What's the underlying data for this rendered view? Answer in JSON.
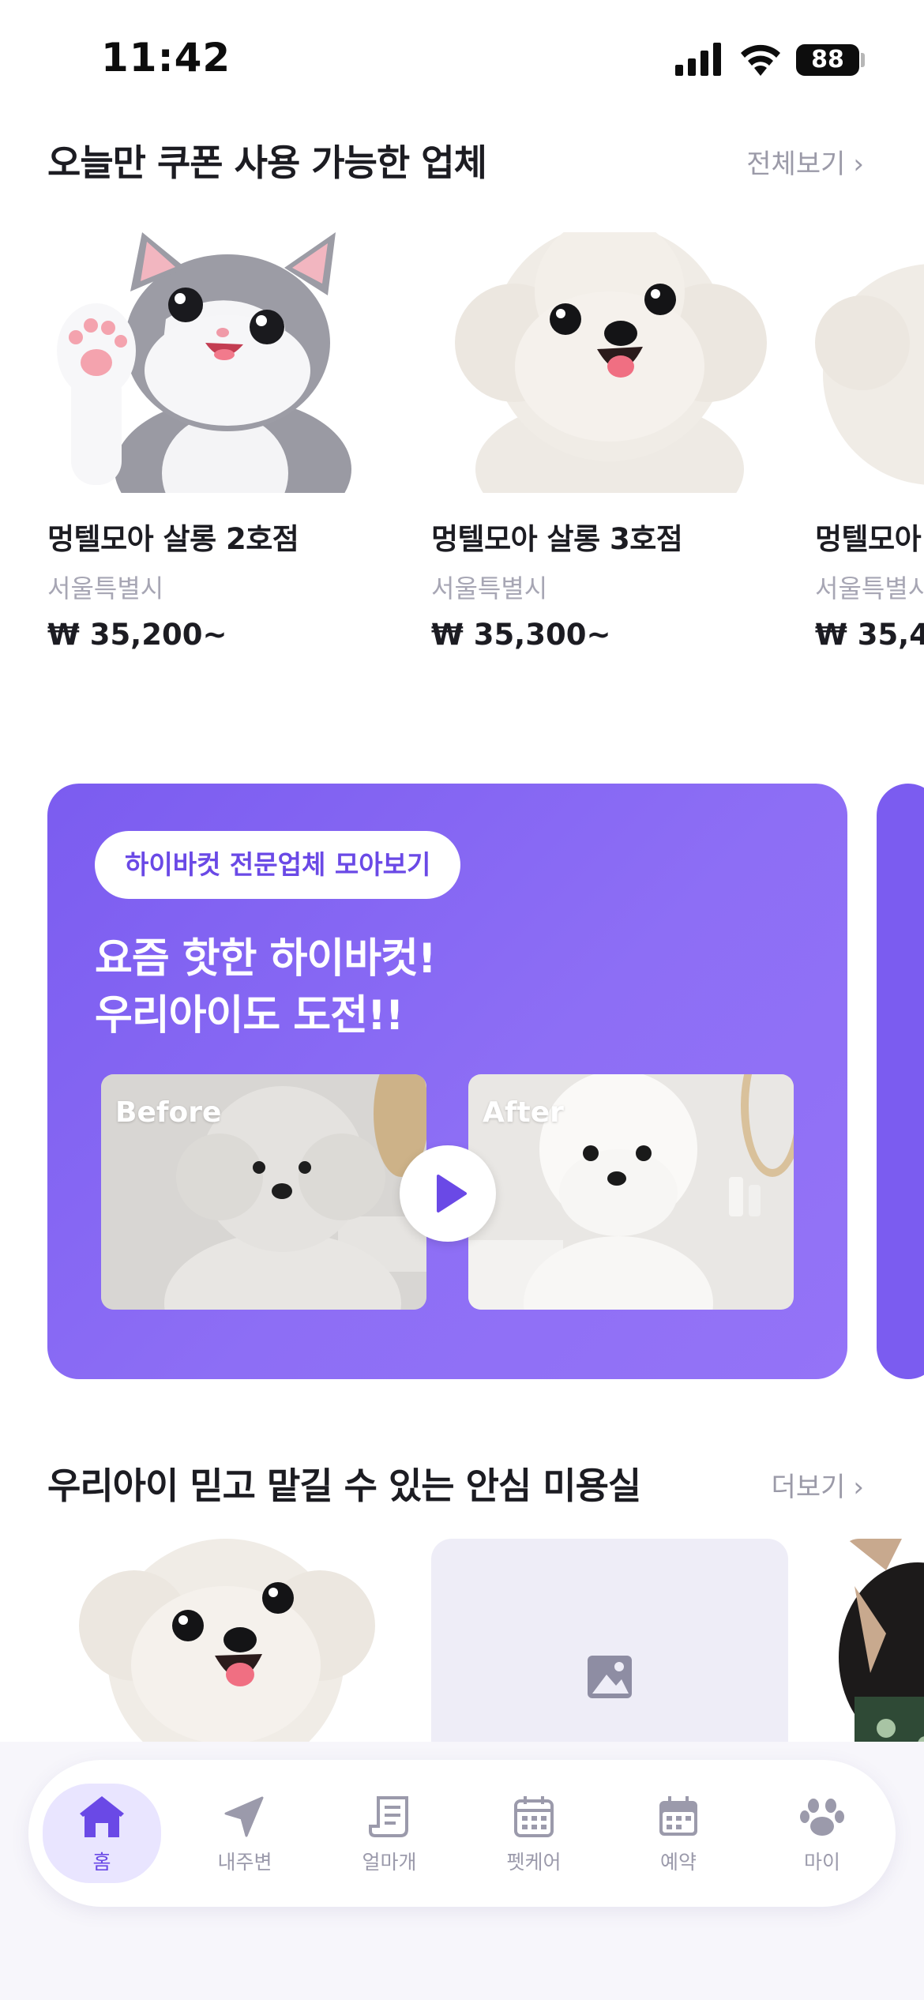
{
  "status_bar": {
    "time": "11:42",
    "battery": "88"
  },
  "coupon_section": {
    "title": "오늘만 쿠폰 사용 가능한 업체",
    "see_all": "전체보기",
    "items": [
      {
        "name": "멍텔모아 살롱 2호점",
        "location": "서울특별시",
        "price": "₩ 35,200~",
        "image": "gray-white-kitten-waving"
      },
      {
        "name": "멍텔모아 살롱 3호점",
        "location": "서울특별시",
        "price": "₩ 35,300~",
        "image": "white-bichon-puppy"
      },
      {
        "name": "멍텔모아",
        "location": "서울특별시",
        "price": "₩ 35,4",
        "image": "white-bichon-puppy"
      }
    ]
  },
  "promo_banner": {
    "chip": "하이바컷 전문업체 모아보기",
    "headline_line1": "요즘 핫한 하이바컷!",
    "headline_line2": "우리아이도 도전!!",
    "before_label": "Before",
    "after_label": "After",
    "accent_color": "#7b5cf0"
  },
  "salon_section": {
    "title": "우리아이 믿고 맡길 수 있는 안심 미용실",
    "more": "더보기",
    "items": [
      {
        "image": "white-bichon-puppy"
      },
      {
        "image": "image-placeholder"
      },
      {
        "image": "black-chihuahua-bandana"
      }
    ]
  },
  "tab_bar": {
    "active_color": "#6a49e6",
    "tabs": [
      {
        "label": "홈",
        "icon": "home-icon",
        "active": true
      },
      {
        "label": "내주변",
        "icon": "location-arrow-icon",
        "active": false
      },
      {
        "label": "얼마개",
        "icon": "receipt-icon",
        "active": false
      },
      {
        "label": "펫케어",
        "icon": "calendar-grid-icon",
        "active": false
      },
      {
        "label": "예약",
        "icon": "calendar-icon",
        "active": false
      },
      {
        "label": "마이",
        "icon": "paw-icon",
        "active": false
      }
    ]
  }
}
